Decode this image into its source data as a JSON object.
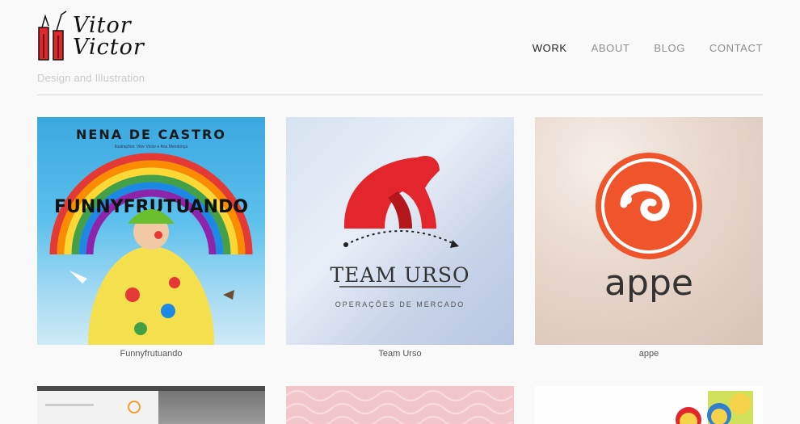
{
  "brand": {
    "name_line1": "Vitor",
    "name_line2": "Victor",
    "tagline": "Design and Illustration"
  },
  "nav": {
    "items": [
      {
        "label": "WORK",
        "active": true
      },
      {
        "label": "ABOUT",
        "active": false
      },
      {
        "label": "BLOG",
        "active": false
      },
      {
        "label": "CONTACT",
        "active": false
      }
    ]
  },
  "projects": [
    {
      "title": "Funnyfrutuando",
      "poster_title": "NENA DE CASTRO",
      "poster_subtitle": "Ilustrações: Vitor Victor e Ana Mendonça",
      "icon": "rainbow-clown-illustration"
    },
    {
      "title": "Team Urso",
      "logo_word": "TEAM URSO",
      "logo_subtitle": "OPERAÇÕES DE MERCADO",
      "icon": "red-bear-logo"
    },
    {
      "title": "appe",
      "logo_word": "appe",
      "icon": "orange-spiral-logo"
    },
    {
      "title": "",
      "icon": "laptop-website-mockup"
    },
    {
      "title": "",
      "icon": "pink-wave-pattern"
    },
    {
      "title": "",
      "icon": "smiley-faces-illustration"
    }
  ],
  "colors": {
    "background": "#f9f9f9",
    "nav_active": "#222222",
    "nav_inactive": "#8d8d8d",
    "brand_red": "#e3262b",
    "appe_orange": "#f0542a"
  }
}
